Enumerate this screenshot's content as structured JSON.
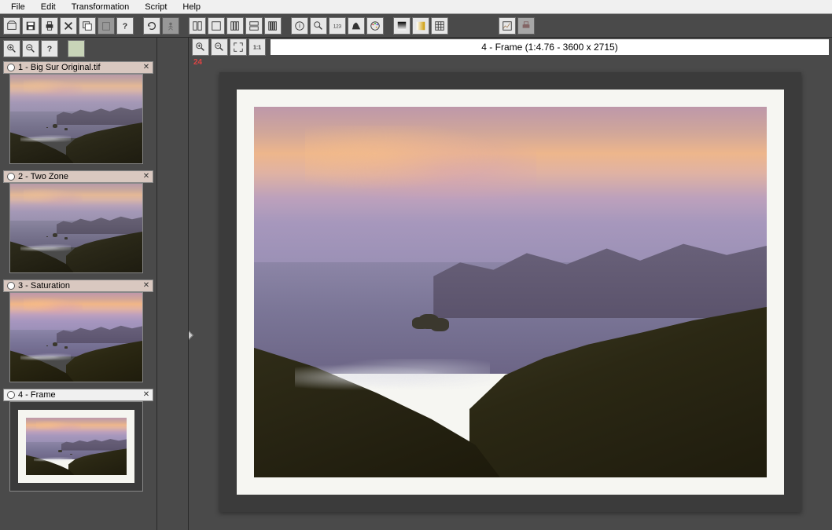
{
  "menu": {
    "file": "File",
    "edit": "Edit",
    "transformation": "Transformation",
    "script": "Script",
    "help": "Help"
  },
  "thumbnails": [
    {
      "label": "1 - Big Sur Original.tif",
      "selected": false
    },
    {
      "label": "2 - Two Zone",
      "selected": false
    },
    {
      "label": "3 - Saturation",
      "selected": false
    },
    {
      "label": "4 - Frame",
      "selected": true
    }
  ],
  "canvas": {
    "title": "4 - Frame (1:4.76 - 3600 x 2715)",
    "ruler_mark": "24"
  }
}
